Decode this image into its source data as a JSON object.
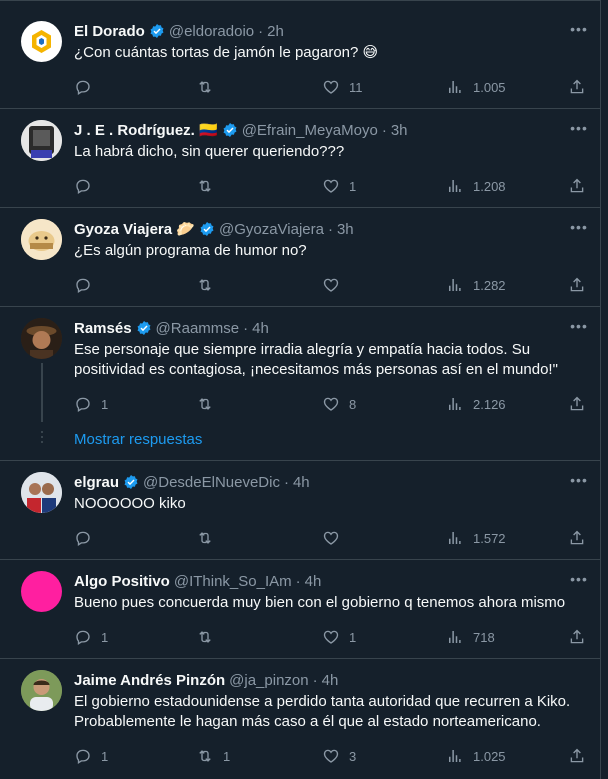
{
  "colors": {
    "background": "#15202b",
    "border": "#38444d",
    "muted": "#8b98a5",
    "accent": "#1d9bf0",
    "text": "#f7f9f9"
  },
  "icons": {
    "reply": "reply-icon",
    "retweet": "retweet-icon",
    "like": "heart-icon",
    "views": "views-bar-icon",
    "share": "share-icon",
    "more": "more-icon",
    "verified": "verified-badge-icon"
  },
  "tweets": [
    {
      "name": "El Dorado",
      "handle": "@eldoradoio",
      "sep": "·",
      "time": "2h",
      "text": "¿Con cuántas tortas de jamón le pagaron? 😅",
      "replies": "",
      "retweets": "",
      "likes": "11",
      "views": "1.005"
    },
    {
      "name": "J . E . Rodríguez. 🇨🇴",
      "handle": "@Efrain_MeyaMoyo",
      "sep": "·",
      "time": "3h",
      "text": "La habrá dicho, sin querer queriendo???",
      "replies": "",
      "retweets": "",
      "likes": "1",
      "views": "1.208"
    },
    {
      "name": "Gyoza Viajera 🥟",
      "handle": "@GyozaViajera",
      "sep": "·",
      "time": "3h",
      "text": "¿Es algún programa de humor no?",
      "replies": "",
      "retweets": "",
      "likes": "",
      "views": "1.282"
    },
    {
      "name": "Ramsés",
      "handle": "@Raammse",
      "sep": "·",
      "time": "4h",
      "text": "Ese personaje que siempre irradia alegría y empatía hacia todos. Su positividad es contagiosa, ¡necesitamos más personas así en el mundo!\"",
      "replies": "1",
      "retweets": "",
      "likes": "8",
      "views": "2.126"
    },
    {
      "name": "elgrau",
      "handle": "@DesdeElNueveDic",
      "sep": "·",
      "time": "4h",
      "text": "NOOOOOO kiko",
      "replies": "",
      "retweets": "",
      "likes": "",
      "views": "1.572"
    },
    {
      "name": "Algo Positivo",
      "handle": "@IThink_So_IAm",
      "sep": "·",
      "time": "4h",
      "text": "Bueno pues concuerda muy bien con el gobierno q tenemos ahora mismo",
      "replies": "1",
      "retweets": "",
      "likes": "1",
      "views": "718"
    },
    {
      "name": "Jaime Andrés Pinzón",
      "handle": "@ja_pinzon",
      "sep": "·",
      "time": "4h",
      "text": "El gobierno estadounidense a perdido tanta autoridad que recurren a Kiko. Probablemente le hagan más caso a él que al estado norteamericano.",
      "replies": "1",
      "retweets": "1",
      "likes": "3",
      "views": "1.025"
    }
  ],
  "show_replies": "Mostrar respuestas"
}
